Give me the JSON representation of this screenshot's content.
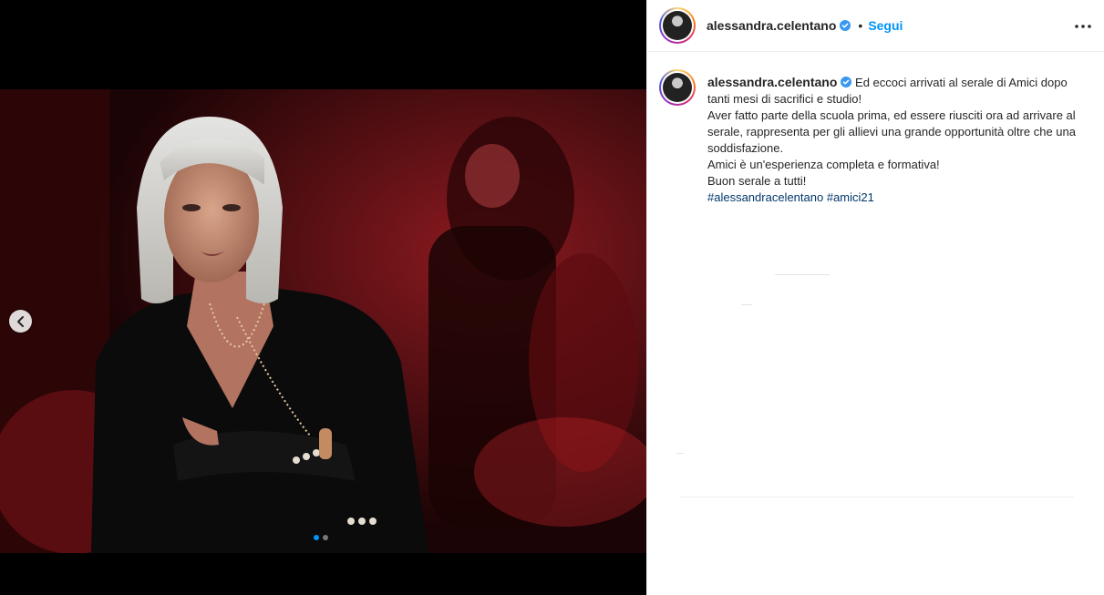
{
  "post": {
    "username": "alessandra.celentano",
    "bullet": "•",
    "follow_label": "Segui",
    "more_icon": "more-options-icon",
    "verified_icon": "verified-badge-icon"
  },
  "caption": {
    "username": "alessandra.celentano",
    "lines": [
      "Ed eccoci arrivati al serale di Amici dopo tanti mesi di sacrifici e studio!",
      "Aver fatto parte della scuola prima, ed essere riusciti ora ad arrivare al serale, rappresenta per gli allievi una grande opportunità oltre che una soddisfazione.",
      "Amici è un'esperienza completa e formativa!",
      "Buon serale a tutti!"
    ],
    "hashtags": [
      "#alessandracelentano",
      "#amici21"
    ]
  },
  "media": {
    "prev_icon": "chevron-left-icon",
    "carousel_dots": 2,
    "active_dot": 0
  },
  "colors": {
    "link": "#0095f6",
    "hashtag": "#00376b",
    "text": "#262626"
  }
}
